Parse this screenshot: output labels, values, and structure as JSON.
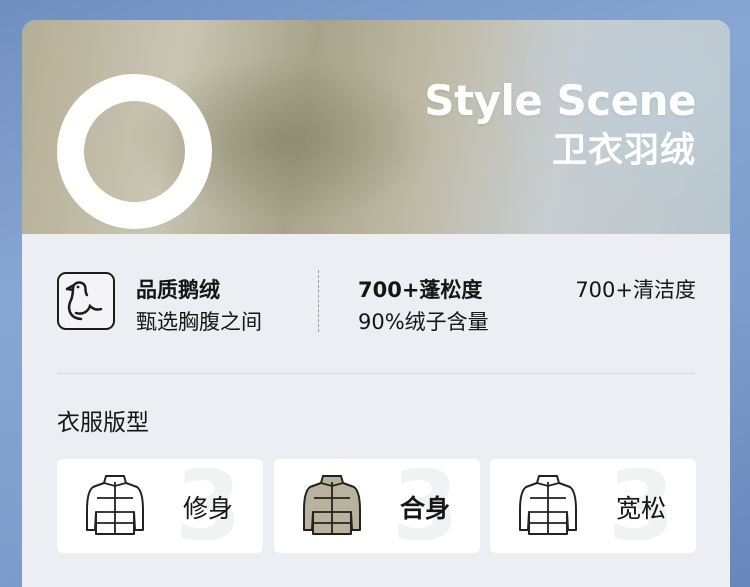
{
  "banner": {
    "title": "Style Scene",
    "subtitle": "卫衣羽绒"
  },
  "features": [
    {
      "title": "品质鹅绒",
      "subtitle": "甄选胸腹之间",
      "icon": "goose-icon"
    },
    {
      "title": "700+蓬松度",
      "subtitle": "90%绒子含量"
    },
    {
      "title": "700+清洁度"
    }
  ],
  "section": {
    "title": "衣服版型"
  },
  "fits": [
    {
      "label": "修身",
      "watermark": "3",
      "icon": "puffer-jacket-icon",
      "selected": false
    },
    {
      "label": "合身",
      "watermark": "3",
      "icon": "puffer-jacket-icon",
      "selected": true
    },
    {
      "label": "宽松",
      "watermark": "3",
      "icon": "puffer-jacket-icon",
      "selected": false
    }
  ],
  "colors": {
    "jacket_selected_fill": "#b9b29c",
    "banner_text": "#ffffff",
    "card_bg": "#eceef3"
  }
}
